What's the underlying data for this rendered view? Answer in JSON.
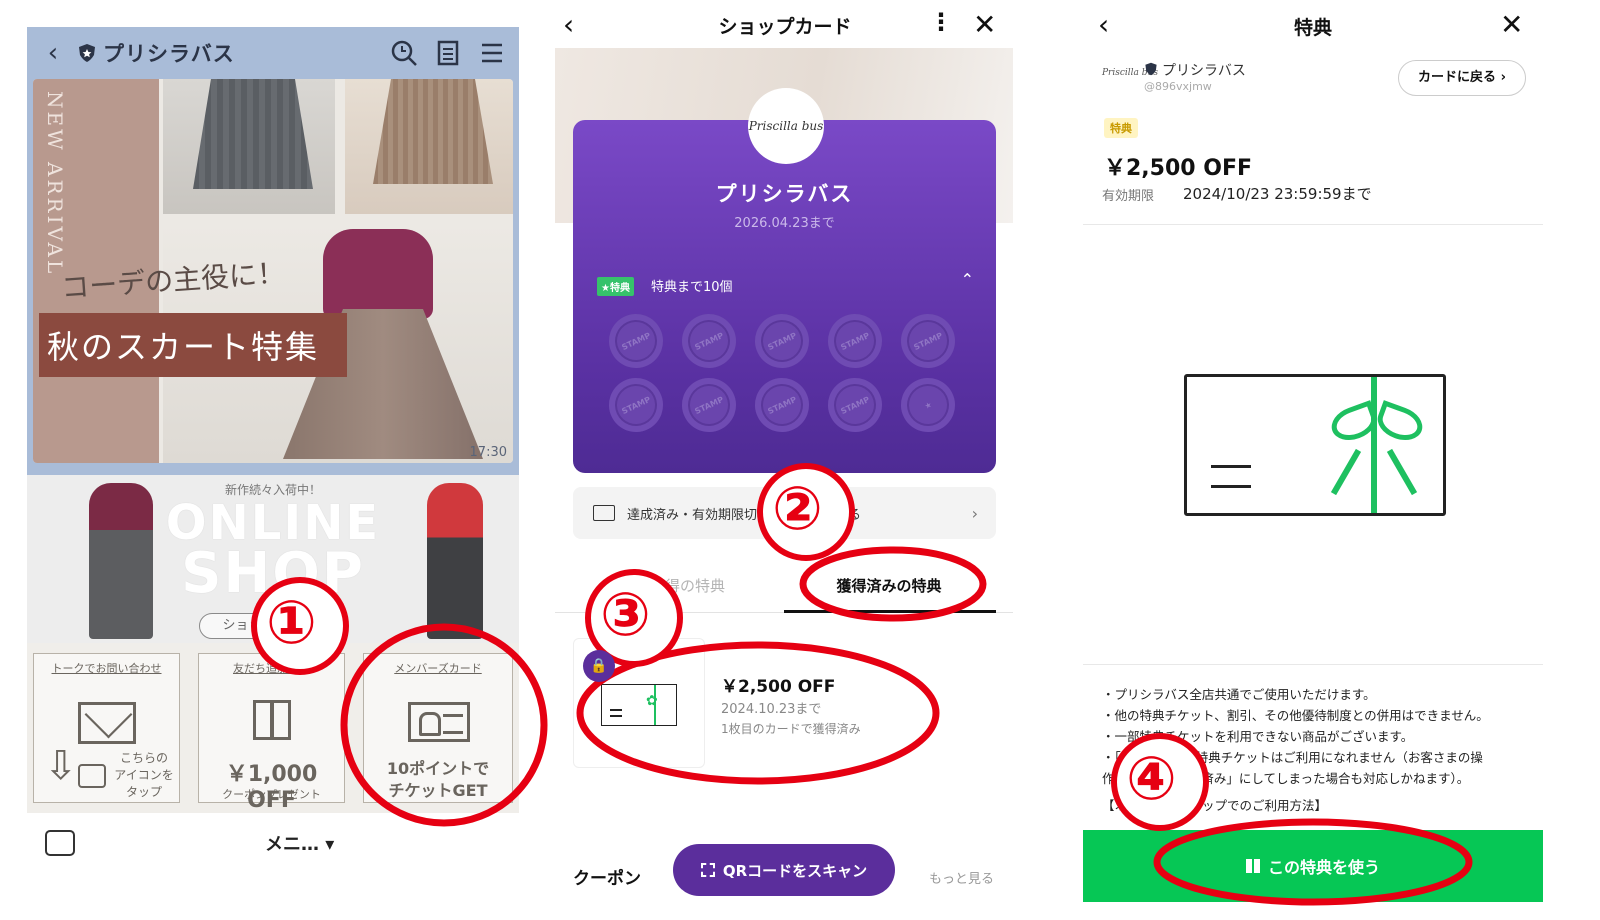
{
  "panel1": {
    "account_name": "プリシラバス",
    "banner": {
      "arrival_text": "NEW ARRIVAL",
      "catch_copy": "コーデの主役に！",
      "title": "秋のスカート特集",
      "timestamp": "17:30"
    },
    "shop_banner": {
      "small_text": "新作続々入荷中！",
      "line1": "ONLINE",
      "line2": "SHOP",
      "button": "ショップをみる▼"
    },
    "menu": {
      "contact_title": "トークでお問い合わせ",
      "contact_tap": "こちらのアイコンをタップ",
      "friend_title": "友だち追加特典",
      "friend_price": "￥1,000 OFF",
      "friend_sub": "クーポンプレゼント",
      "member_title": "メンバーズカード",
      "member_text1": "10ポイントで",
      "member_text2": "チケットGET"
    },
    "bottom_menu_label": "メニ… ▾"
  },
  "panel2": {
    "header_title": "ショップカード",
    "card": {
      "logo_text": "Priscilla bus",
      "name": "プリシラバス",
      "expiry": "2026.04.23まで",
      "badge": "★特典",
      "until_text": "特典まで10個",
      "stamp_label": "STAMP"
    },
    "history_link": "達成済み・有効期限切れのカードを見る",
    "tabs": [
      "未獲得の特典",
      "獲得済みの特典"
    ],
    "coupon": {
      "price": "￥2,500 OFF",
      "date": "2024.10.23まで",
      "acquired": "1枚目のカードで獲得済み"
    },
    "bottom": {
      "coupon_label": "クーポン",
      "scan_button": "QRコードをスキャン",
      "more_link": "もっと見る"
    }
  },
  "panel3": {
    "header_title": "特典",
    "account": {
      "logo_text": "Priscilla bus",
      "name": "プリシラバス",
      "handle": "@896vxjmw",
      "back_button": "カードに戻る ›"
    },
    "tag": "特典",
    "price": "￥2,500 OFF",
    "expiry_label": "有効期限",
    "expiry_value": "2024/10/23 23:59:59まで",
    "notes": [
      "・プリシラバス全店共通でご使用いただけます。",
      "・他の特典チケット、割引、その他優待制度との併用はできません。",
      "・一部特典チケットを利用できない商品がございます。",
      "・「使用済み」の特典チケットはご利用になれません（お客さまの操",
      "作で誤って「使用済み」にしてしまった場合も対応しかねます）。",
      "",
      "【オンラインショップでのご利用方法】"
    ],
    "use_button": "この特典を使う"
  },
  "annotations": {
    "steps": [
      "①",
      "②",
      "③",
      "④"
    ],
    "color": "#e60012"
  }
}
